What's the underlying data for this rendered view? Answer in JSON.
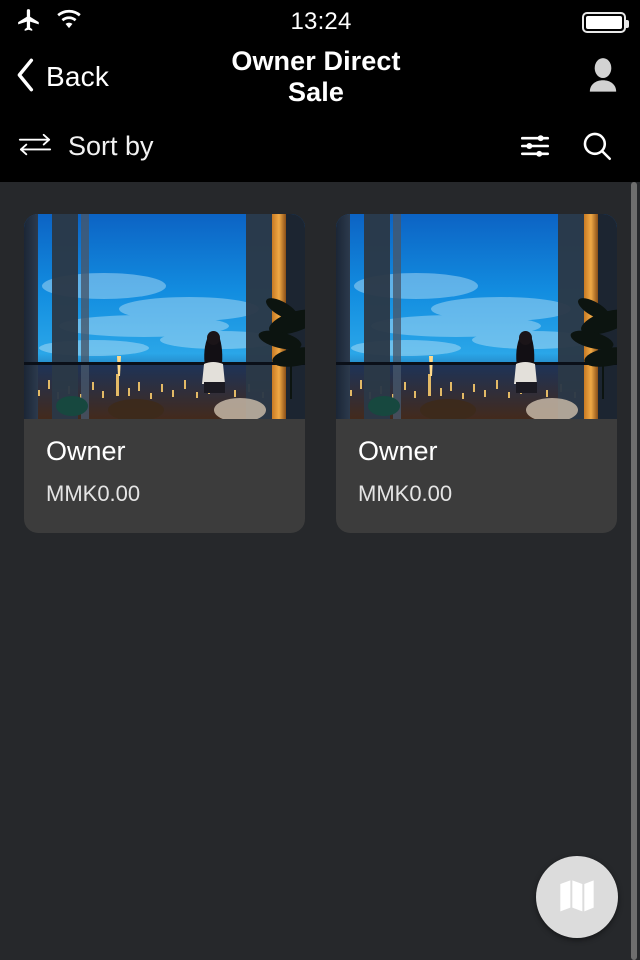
{
  "status_bar": {
    "airplane_icon": "airplane-icon",
    "wifi_icon": "wifi-icon",
    "time": "13:24",
    "battery_icon": "battery-full-icon"
  },
  "nav_bar": {
    "back_icon": "chevron-left-icon",
    "back_label": "Back",
    "title": "Owner Direct Sale",
    "profile_icon": "person-icon"
  },
  "toolbar": {
    "sort_icon": "sort-arrows-icon",
    "sort_label": "Sort by",
    "filter_icon": "filter-sliders-icon",
    "search_icon": "search-icon"
  },
  "listing": {
    "cards": [
      {
        "title": "Owner",
        "price": "MMK0.00",
        "image_alt": "night-city-window-view"
      },
      {
        "title": "Owner",
        "price": "MMK0.00",
        "image_alt": "night-city-window-view"
      }
    ]
  },
  "fab": {
    "icon": "map-icon"
  },
  "colors": {
    "header_background": "#000000",
    "content_background": "#26282b",
    "card_background": "#3c3c3c",
    "text_primary": "#ffffff",
    "scrollbar": "#6e6e6e",
    "fab_background": "#dcdcdc"
  }
}
